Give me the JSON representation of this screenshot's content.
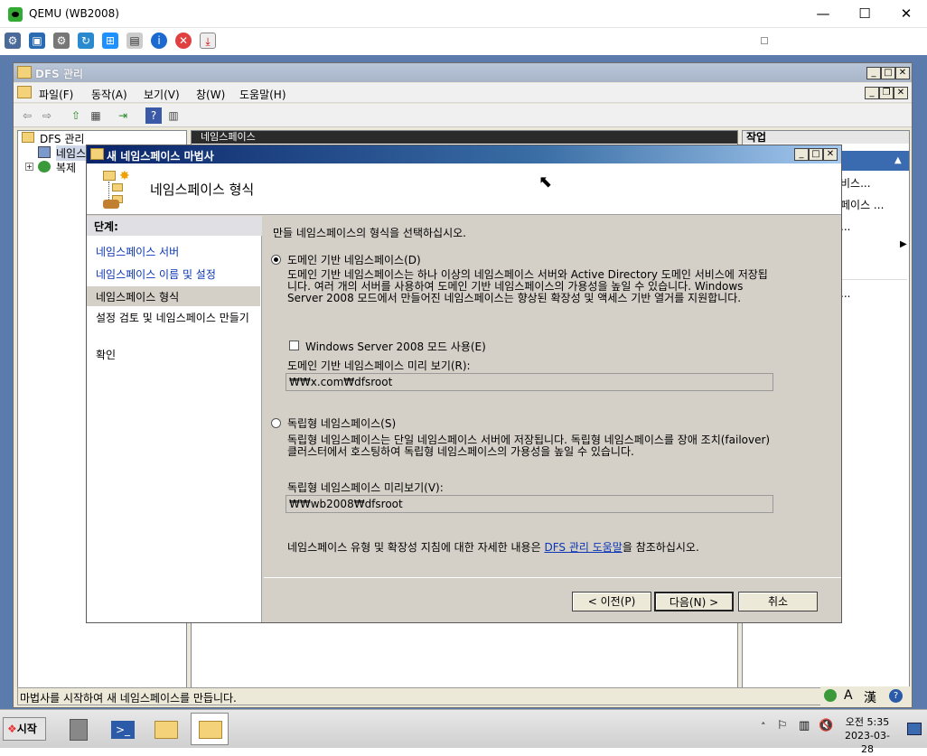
{
  "host": {
    "title": "QEMU (WB2008)",
    "buttons": {
      "minimize": "—",
      "maximize": "☐",
      "close": "✕"
    }
  },
  "mmc": {
    "title": "DFS 관리",
    "menu": [
      "파일(F)",
      "동작(A)",
      "보기(V)",
      "창(W)",
      "도움말(H)"
    ],
    "tree": {
      "root": "DFS 관리",
      "namespaces": "네임스",
      "replication": "복제"
    },
    "center_header": "네임스페이스",
    "actions_header": "작업",
    "action_items": [
      "비스...",
      "페이스 ...",
      "...",
      "..."
    ],
    "status": "마법사를 시작하여 새 네임스페이스를 만듭니다."
  },
  "wizard": {
    "title": "새 네임스페이스 마법사",
    "heading": "네임스페이스 형식",
    "steps_header": "단계:",
    "steps": [
      "네임스페이스 서버",
      "네임스페이스 이름 및 설정",
      "네임스페이스 형식",
      "설정 검토 및 네임스페이스 만들기",
      "확인"
    ],
    "prompt": "만들 네임스페이스의 형식을 선택하십시오.",
    "domain_label": "도메인 기반 네임스페이스(D)",
    "domain_desc": "도메인 기반 네임스페이스는 하나 이상의 네임스페이스 서버와 Active Directory 도메인 서비스에 저장됩니다. 여러 개의 서버를 사용하여 도메인 기반 네임스페이스의 가용성을 높일 수 있습니다. Windows Server 2008 모드에서 만들어진 네임스페이스는 향상된 확장성 및 액세스 기반 열거를 지원합니다.",
    "mode_checkbox": "Windows Server 2008 모드 사용(E)",
    "domain_preview_label": "도메인 기반 네임스페이스 미리 보기(R):",
    "domain_preview": "₩₩x.com₩dfsroot",
    "standalone_label": "독립형 네임스페이스(S)",
    "standalone_desc": "독립형 네임스페이스는 단일 네임스페이스 서버에 저장됩니다. 독립형 네임스페이스를 장애 조치(failover) 클러스터에서 호스팅하여 독립형 네임스페이스의 가용성을 높일 수 있습니다.",
    "standalone_preview_label": "독립형 네임스페이스 미리보기(V):",
    "standalone_preview": "₩₩wb2008₩dfsroot",
    "footer_pre": "네임스페이스 유형 및 확장성 지침에 대한 자세한 내용은 ",
    "footer_link": "DFS 관리 도움말",
    "footer_post": "을 참조하십시오.",
    "btn_back": "< 이전(P)",
    "btn_next": "다음(N) >",
    "btn_cancel": "취소"
  },
  "taskbar": {
    "start": "시작",
    "time": "오전 5:35",
    "date": "2023-03-28"
  }
}
